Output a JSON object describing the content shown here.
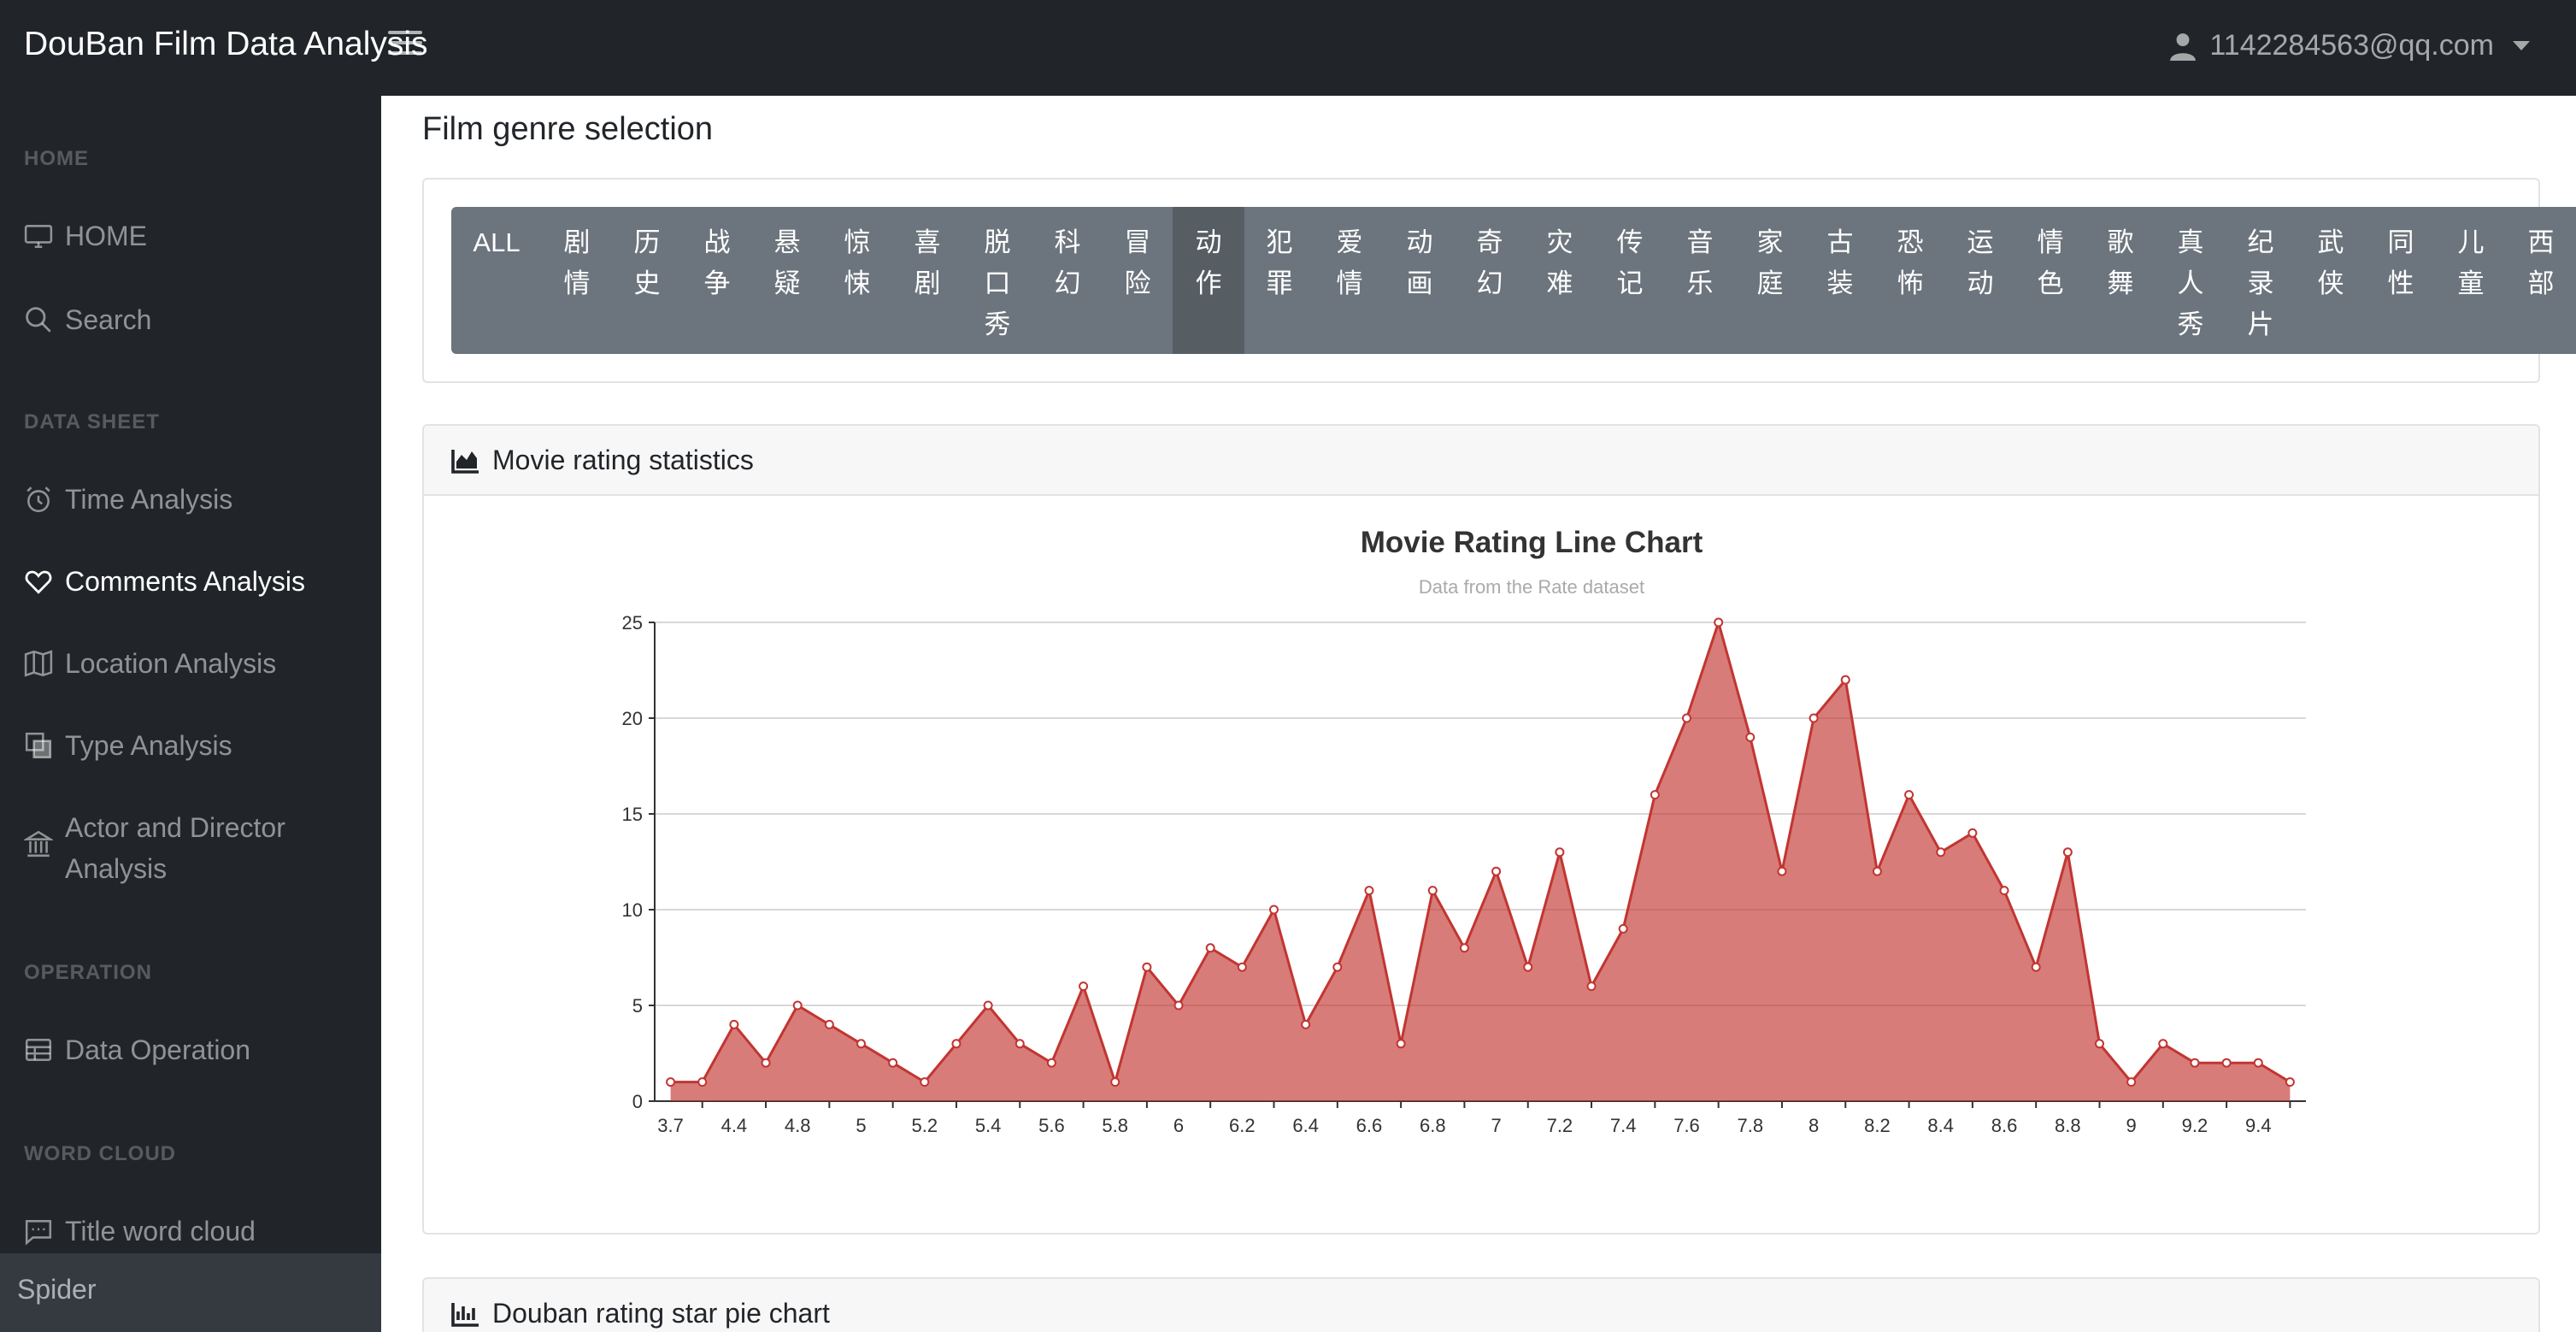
{
  "navbar": {
    "brand": "DouBan Film Data Analysis",
    "user_email": "1142284563@qq.com"
  },
  "sidebar": {
    "sections": [
      {
        "heading": "HOME",
        "items": [
          {
            "label": "HOME",
            "icon": "desktop-icon"
          },
          {
            "label": "Search",
            "icon": "search-icon"
          }
        ]
      },
      {
        "heading": "DATA SHEET",
        "items": [
          {
            "label": "Time Analysis",
            "icon": "alarm-clock-icon"
          },
          {
            "label": "Comments Analysis",
            "icon": "heart-icon",
            "active": true
          },
          {
            "label": "Location Analysis",
            "icon": "map-icon"
          },
          {
            "label": "Type Analysis",
            "icon": "copy-icon"
          },
          {
            "label": "Actor and Director Analysis",
            "icon": "bank-icon"
          }
        ]
      },
      {
        "heading": "OPERATION",
        "items": [
          {
            "label": "Data Operation",
            "icon": "table-icon"
          }
        ]
      },
      {
        "heading": "WORD CLOUD",
        "items": [
          {
            "label": "Title word cloud",
            "icon": "chat-icon"
          }
        ]
      }
    ],
    "footer": "Spider"
  },
  "main": {
    "section_title": "Film genre selection",
    "genres": [
      "ALL",
      "剧情",
      "历史",
      "战争",
      "悬疑",
      "惊悚",
      "喜剧",
      "脱口秀",
      "科幻",
      "冒险",
      "动作",
      "犯罪",
      "爱情",
      "动画",
      "奇幻",
      "灾难",
      "传记",
      "音乐",
      "家庭",
      "古装",
      "恐怖",
      "运动",
      "情色",
      "歌舞",
      "真人秀",
      "纪录片",
      "武侠",
      "同性",
      "儿童",
      "西部"
    ],
    "active_genre": "动作",
    "rating_card_title": "Movie rating statistics",
    "pie_card_title": "Douban rating star pie chart"
  },
  "chart_data": {
    "type": "area",
    "title": "Movie Rating Line Chart",
    "subtitle": "Data from the Rate dataset",
    "x": [
      3.7,
      3.8,
      4.4,
      4.5,
      4.8,
      4.9,
      5,
      5.1,
      5.2,
      5.3,
      5.4,
      5.5,
      5.6,
      5.7,
      5.8,
      5.9,
      6,
      6.1,
      6.2,
      6.3,
      6.4,
      6.5,
      6.6,
      6.7,
      6.8,
      6.9,
      7,
      7.1,
      7.2,
      7.3,
      7.4,
      7.5,
      7.6,
      7.7,
      7.8,
      7.9,
      8,
      8.1,
      8.2,
      8.3,
      8.4,
      8.5,
      8.6,
      8.7,
      8.8,
      8.9,
      9,
      9.1,
      9.2,
      9.3,
      9.4,
      9.5
    ],
    "xticks": [
      "3.7",
      "4.4",
      "4.8",
      "5",
      "5.2",
      "5.4",
      "5.6",
      "5.8",
      "6",
      "6.2",
      "6.4",
      "6.6",
      "6.8",
      "7",
      "7.2",
      "7.4",
      "7.6",
      "7.8",
      "8",
      "8.2",
      "8.4",
      "8.6",
      "8.8",
      "9",
      "9.2",
      "9.4"
    ],
    "values": [
      1,
      1,
      4,
      2,
      5,
      4,
      3,
      2,
      1,
      3,
      5,
      3,
      2,
      6,
      1,
      7,
      5,
      8,
      7,
      10,
      4,
      7,
      11,
      3,
      11,
      8,
      12,
      7,
      13,
      6,
      9,
      16,
      20,
      25,
      19,
      12,
      20,
      22,
      12,
      16,
      13,
      14,
      11,
      7,
      13,
      3,
      1,
      3,
      2,
      2,
      2,
      1
    ],
    "ylim": [
      0,
      25
    ],
    "yticks": [
      0,
      5,
      10,
      15,
      20,
      25
    ],
    "grid": true,
    "colors": {
      "line": "#c23531",
      "fill": "#c23531"
    }
  }
}
